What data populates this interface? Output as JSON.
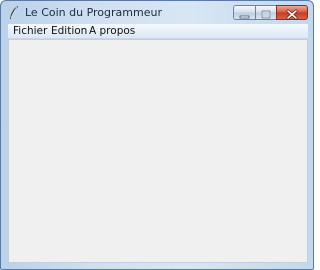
{
  "window": {
    "title": "Le Coin du Programmeur",
    "icon": "feather-icon",
    "controls": {
      "minimize_icon": "minimize-icon",
      "maximize_icon": "maximize-icon",
      "close_icon": "close-icon"
    }
  },
  "menubar": {
    "items": [
      {
        "label": "Fichier"
      },
      {
        "label": "Edition"
      },
      {
        "label": "A propos"
      }
    ]
  },
  "colors": {
    "close_button": "#c43a20",
    "client_background": "#f0f0f0",
    "frame_accent": "#b9d1ea"
  }
}
